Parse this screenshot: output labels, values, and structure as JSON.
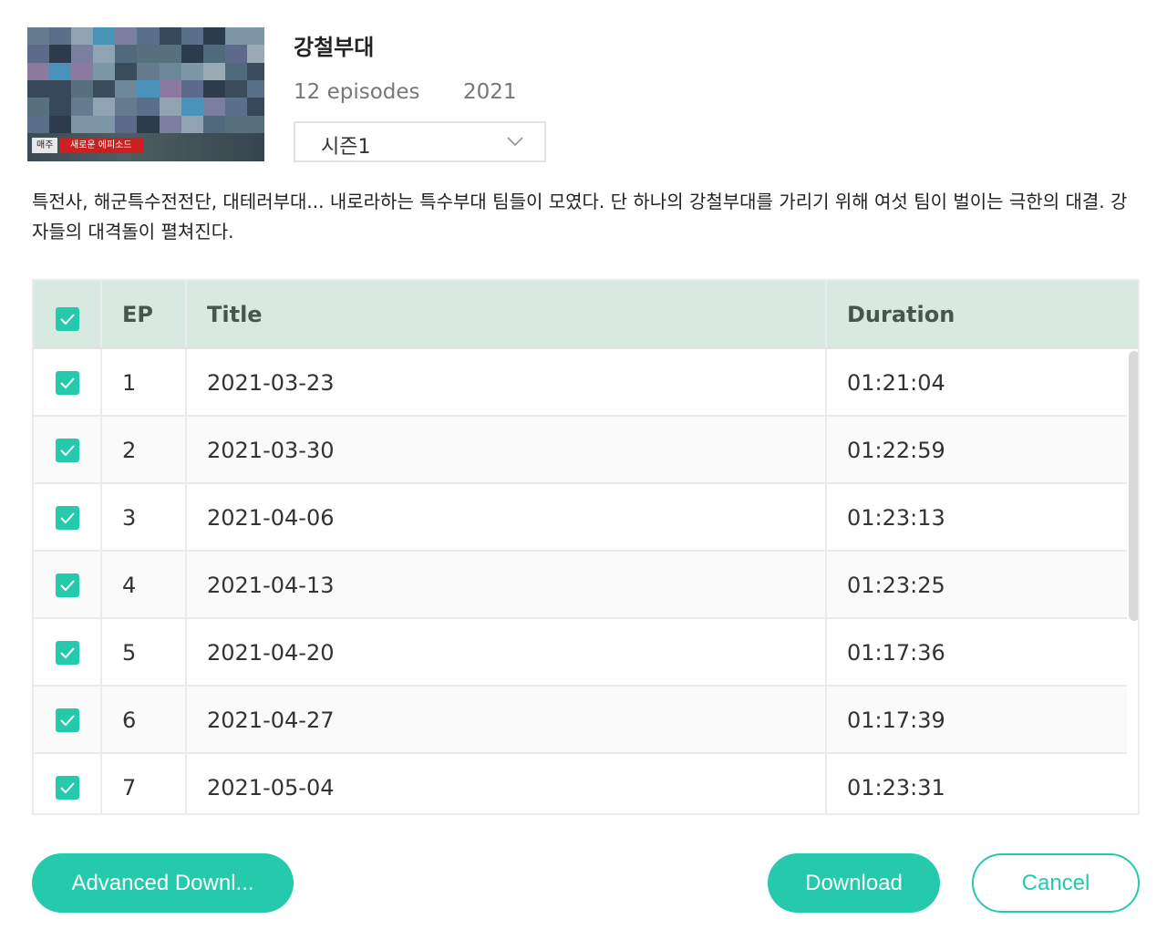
{
  "thumbnail": {
    "badge_week": "매주",
    "badge_new": "새로운 에피소드"
  },
  "show": {
    "title": "강철부대",
    "episodes": "12 episodes",
    "year": "2021",
    "season_selected": "시즌1",
    "description": "특전사, 해군특수전전단, 대테러부대... 내로라하는 특수부대 팀들이 모였다. 단 하나의 강철부대를 가리기 위해 여섯 팀이 벌이는 극한의 대결. 강자들의 대격돌이 펼쳐진다."
  },
  "table": {
    "headers": {
      "ep": "EP",
      "title": "Title",
      "duration": "Duration"
    },
    "select_all_checked": true,
    "rows": [
      {
        "ep": "1",
        "title": "2021-03-23",
        "duration": "01:21:04",
        "checked": true
      },
      {
        "ep": "2",
        "title": "2021-03-30",
        "duration": "01:22:59",
        "checked": true
      },
      {
        "ep": "3",
        "title": "2021-04-06",
        "duration": "01:23:13",
        "checked": true
      },
      {
        "ep": "4",
        "title": "2021-04-13",
        "duration": "01:23:25",
        "checked": true
      },
      {
        "ep": "5",
        "title": "2021-04-20",
        "duration": "01:17:36",
        "checked": true
      },
      {
        "ep": "6",
        "title": "2021-04-27",
        "duration": "01:17:39",
        "checked": true
      },
      {
        "ep": "7",
        "title": "2021-05-04",
        "duration": "01:23:31",
        "checked": true
      }
    ]
  },
  "buttons": {
    "advanced": "Advanced Downl...",
    "download": "Download",
    "cancel": "Cancel"
  },
  "colors": {
    "accent": "#25c9ab",
    "header_bg": "#d7e9e1",
    "badge_red": "#cc1f1f"
  },
  "icons": {
    "select_chevron": "chevron-down-icon",
    "checkbox": "check-icon"
  }
}
